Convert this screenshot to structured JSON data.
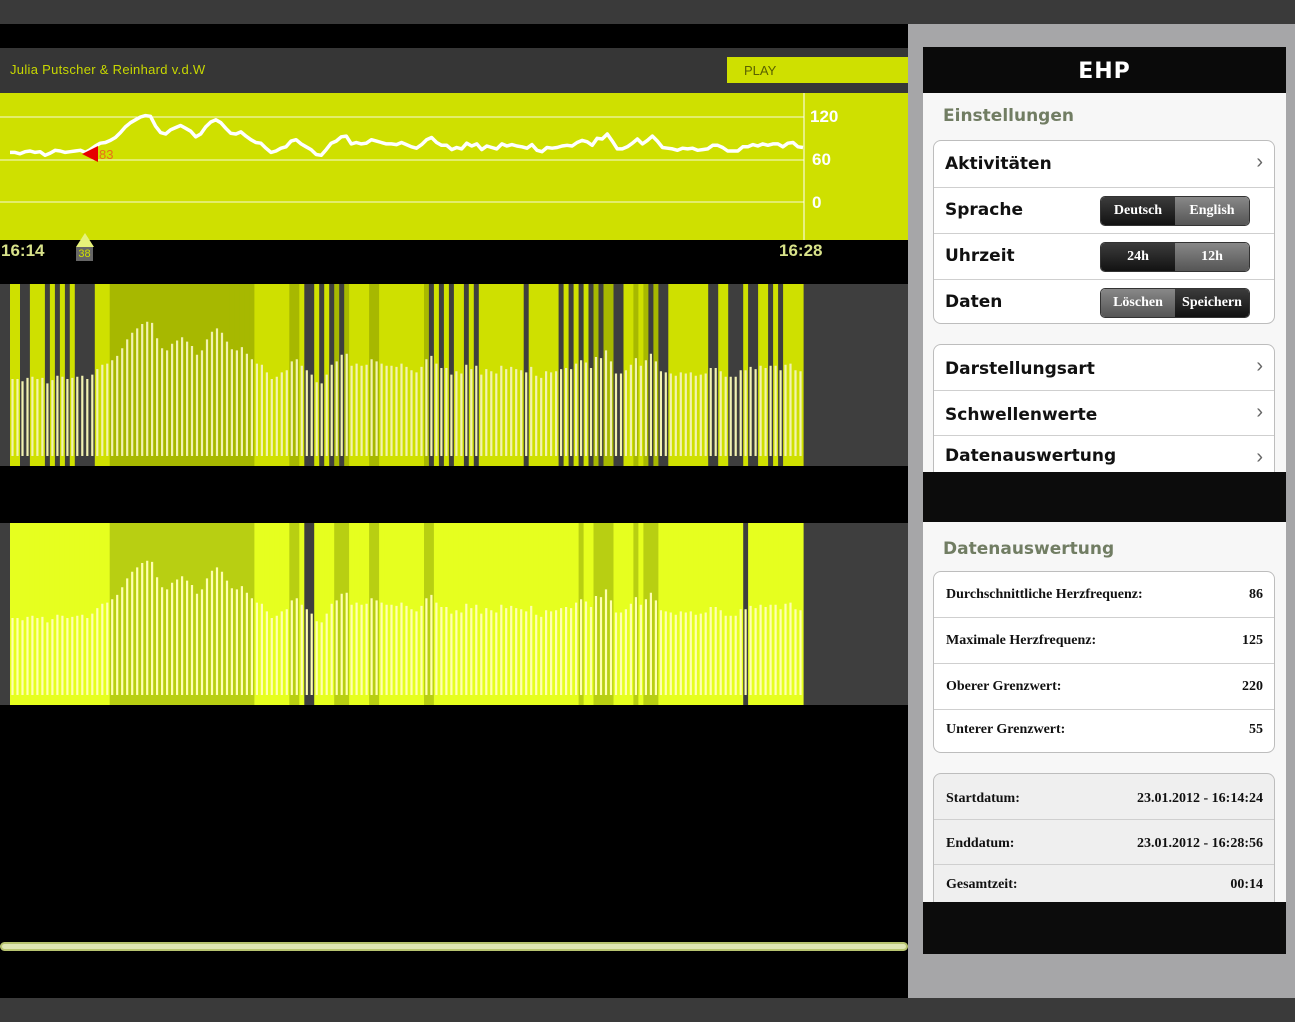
{
  "header": {
    "user": "Julia Putscher & Reinhard v.d.W",
    "play_label": "PLAY"
  },
  "chart_data": {
    "type": "line",
    "y_ticks": [
      "120",
      "60",
      "0"
    ],
    "start_time": "16:14",
    "end_time": "16:28",
    "marker_value": "83",
    "marker_position_label": "38",
    "series": [
      {
        "values": [
          70,
          70,
          68,
          71,
          72,
          70,
          71,
          66,
          69,
          73,
          72,
          70,
          71,
          72,
          73,
          70,
          74,
          79,
          83,
          84,
          87,
          91,
          98,
          106,
          112,
          116,
          120,
          122,
          121,
          107,
          98,
          96,
          102,
          105,
          108,
          104,
          100,
          92,
          96,
          106,
          113,
          116,
          112,
          104,
          97,
          96,
          99,
          93,
          88,
          84,
          83,
          76,
          70,
          72,
          76,
          78,
          86,
          88,
          82,
          78,
          74,
          67,
          66,
          74,
          83,
          86,
          92,
          93,
          82,
          84,
          82,
          83,
          88,
          86,
          84,
          82,
          82,
          81,
          84,
          81,
          78,
          76,
          81,
          88,
          91,
          84,
          80,
          80,
          74,
          77,
          75,
          83,
          79,
          82,
          74,
          79,
          77,
          75,
          82,
          79,
          81,
          79,
          78,
          76,
          81,
          73,
          71,
          77,
          76,
          77,
          79,
          80,
          79,
          84,
          87,
          85,
          80,
          90,
          89,
          96,
          86,
          75,
          75,
          78,
          83,
          89,
          82,
          87,
          93,
          86,
          77,
          76,
          75,
          73,
          76,
          75,
          76,
          73,
          74,
          75,
          80,
          80,
          77,
          72,
          72,
          72,
          78,
          78,
          81,
          79,
          82,
          80,
          82,
          82,
          78,
          83,
          84,
          78,
          77
        ]
      }
    ]
  },
  "settings_panel": {
    "brand": "EHP",
    "section_title": "Einstellungen",
    "rows": {
      "activities": "Aktivitäten",
      "language": "Sprache",
      "time": "Uhrzeit",
      "data": "Daten",
      "display_mode": "Darstellungsart",
      "thresholds": "Schwellenwerte",
      "data_eval": "Datenauswertung"
    },
    "language_opts": {
      "a": "Deutsch",
      "b": "English"
    },
    "time_opts": {
      "a": "24h",
      "b": "12h"
    },
    "data_opts": {
      "a": "Löschen",
      "b": "Speichern"
    }
  },
  "eval_panel": {
    "section_title": "Datenauswertung",
    "stats": [
      {
        "label": "Durchschnittliche Herzfrequenz:",
        "value": "86"
      },
      {
        "label": "Maximale Herzfrequenz:",
        "value": "125"
      },
      {
        "label": "Oberer Grenzwert:",
        "value": "220"
      },
      {
        "label": "Unterer Grenzwert:",
        "value": "55"
      }
    ],
    "dates": [
      {
        "label": "Startdatum:",
        "value": "23.01.2012 - 16:14:24"
      },
      {
        "label": "Enddatum:",
        "value": "23.01.2012 - 16:28:56"
      },
      {
        "label": "Gesamtzeit:",
        "value": "00:14"
      }
    ]
  },
  "colors": {
    "accent": "#cfe000",
    "bright": "#e6ff1f",
    "dark": "#3e3e3e"
  }
}
